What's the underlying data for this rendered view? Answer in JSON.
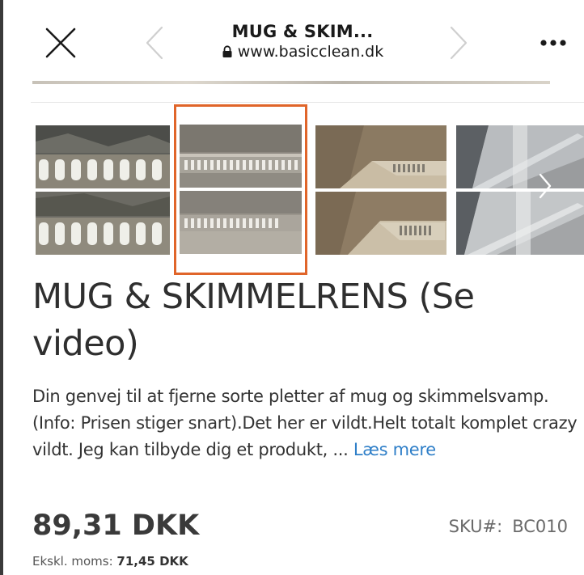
{
  "browser": {
    "title": "MUG & SKIM...",
    "url": "www.basicclean.dk",
    "close_icon": "close-icon",
    "back_icon": "chevron-left-icon",
    "forward_icon": "chevron-right-icon",
    "more_icon": "more-horizontal-icon",
    "lock_icon": "lock-icon"
  },
  "gallery": {
    "selected_index": 1,
    "selected_border_color": "#e0652a",
    "thumbnails": [
      {
        "name": "thumbnail-1"
      },
      {
        "name": "thumbnail-2"
      },
      {
        "name": "thumbnail-3"
      },
      {
        "name": "thumbnail-4"
      }
    ],
    "next_icon": "chevron-right-icon"
  },
  "product": {
    "title": "MUG & SKIMMELRENS (Se video)",
    "description": "Din genvej til at fjerne sorte pletter af mug og skimmelsvamp. (Info: Prisen stiger snart).Det her er vildt.Helt totalt komplet crazy vildt. Jeg kan tilbyde dig et produkt, ... ",
    "read_more": "Læs mere",
    "read_more_color": "#2f7fc8",
    "price": "89,31 DKK",
    "sku_label": "SKU#:",
    "sku_value": "BC010",
    "excl_label": "Ekskl. moms: ",
    "excl_value": "71,45 DKK"
  }
}
